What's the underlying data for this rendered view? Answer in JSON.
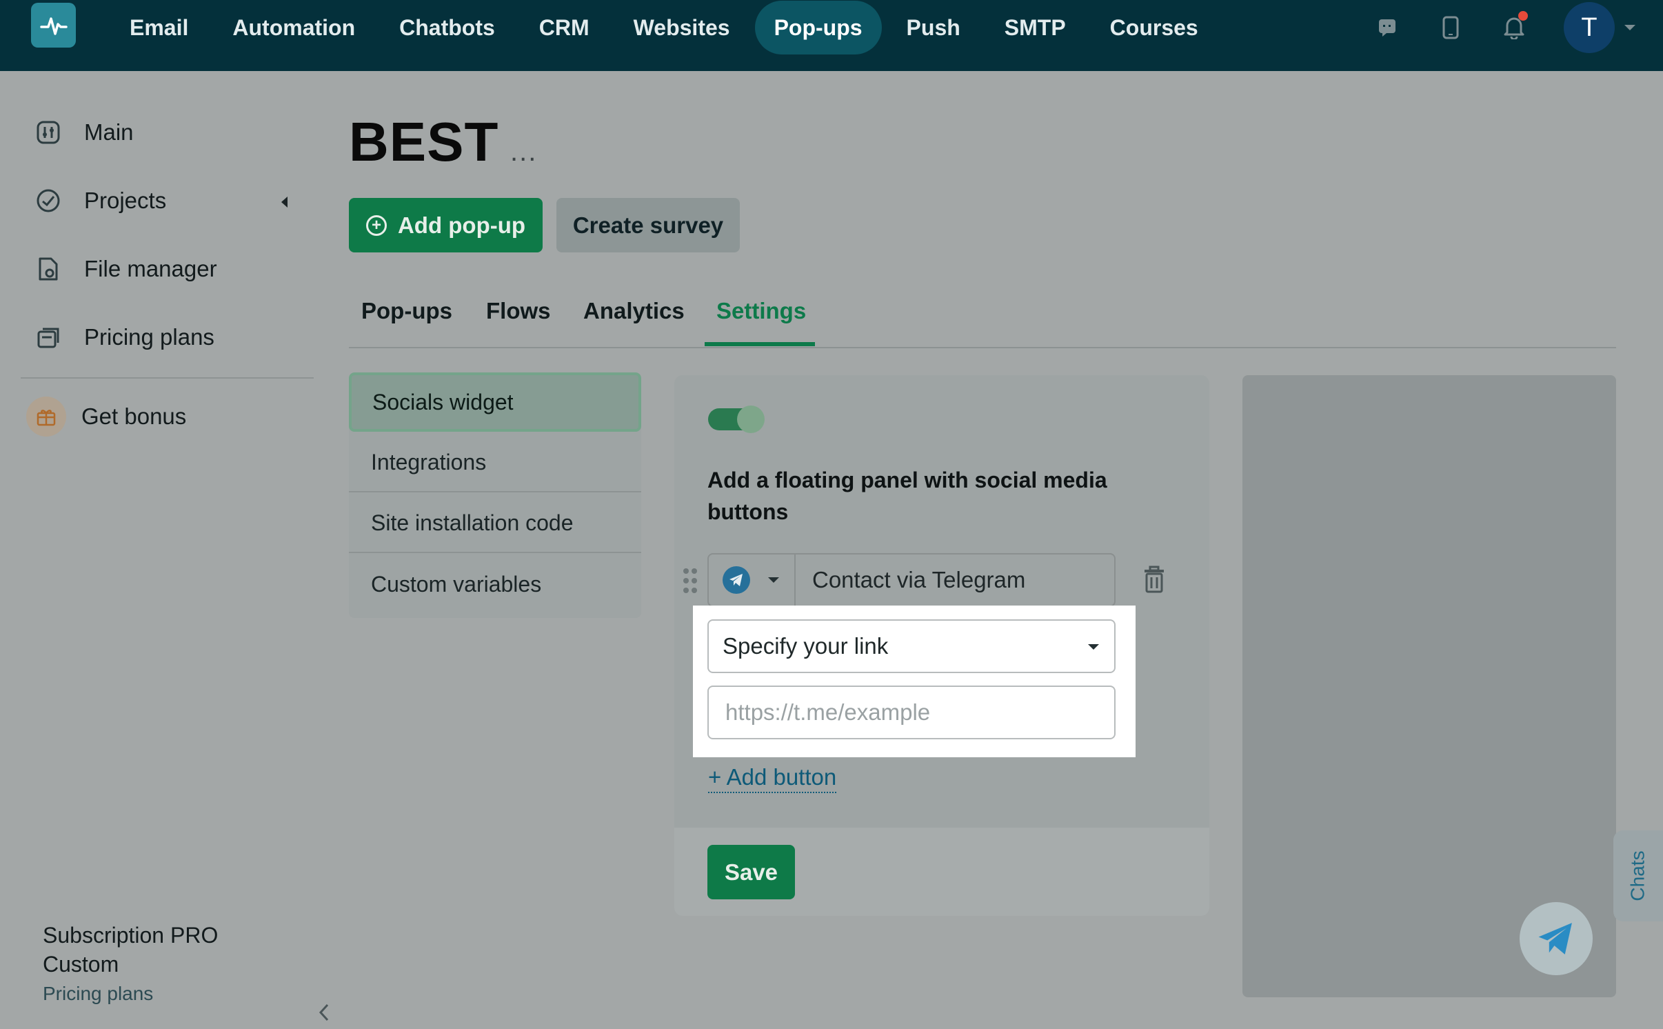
{
  "topnav": {
    "items": [
      {
        "label": "Email",
        "active": false
      },
      {
        "label": "Automation",
        "active": false
      },
      {
        "label": "Chatbots",
        "active": false
      },
      {
        "label": "CRM",
        "active": false
      },
      {
        "label": "Websites",
        "active": false
      },
      {
        "label": "Pop-ups",
        "active": true
      },
      {
        "label": "Push",
        "active": false
      },
      {
        "label": "SMTP",
        "active": false
      },
      {
        "label": "Courses",
        "active": false
      }
    ],
    "avatar_initial": "T"
  },
  "sidebar": {
    "items": [
      {
        "label": "Main",
        "icon": "dashboard-icon"
      },
      {
        "label": "Projects",
        "icon": "projects-icon"
      },
      {
        "label": "File manager",
        "icon": "file-manager-icon"
      },
      {
        "label": "Pricing plans",
        "icon": "pricing-plans-icon"
      },
      {
        "label": "Get bonus",
        "icon": "gift-icon"
      }
    ],
    "subscription_title": "Subscription PRO Custom",
    "subscription_link": "Pricing plans"
  },
  "page": {
    "title": "BEST",
    "more": "...",
    "add_popup_label": "Add pop-up",
    "create_survey_label": "Create survey"
  },
  "tabs": [
    {
      "label": "Pop-ups",
      "active": false
    },
    {
      "label": "Flows",
      "active": false
    },
    {
      "label": "Analytics",
      "active": false
    },
    {
      "label": "Settings",
      "active": true
    }
  ],
  "settings_menu": [
    {
      "label": "Socials widget",
      "active": true
    },
    {
      "label": "Integrations",
      "active": false
    },
    {
      "label": "Site installation code",
      "active": false
    },
    {
      "label": "Custom variables",
      "active": false
    }
  ],
  "panel": {
    "toggle_on": true,
    "heading": "Add a floating panel with social media buttons",
    "social_label": "Contact via Telegram",
    "link_select_value": "Specify your link",
    "url_placeholder": "https://t.me/example",
    "add_button_label": "+ Add button",
    "save_label": "Save"
  },
  "widgets": {
    "chats_label": "Chats"
  },
  "colors": {
    "topbar": "#04303b",
    "accent_green": "#0e7a48",
    "active_tab": "#0d7a4a",
    "link_blue": "#0e5a78",
    "telegram": "#26709a"
  }
}
